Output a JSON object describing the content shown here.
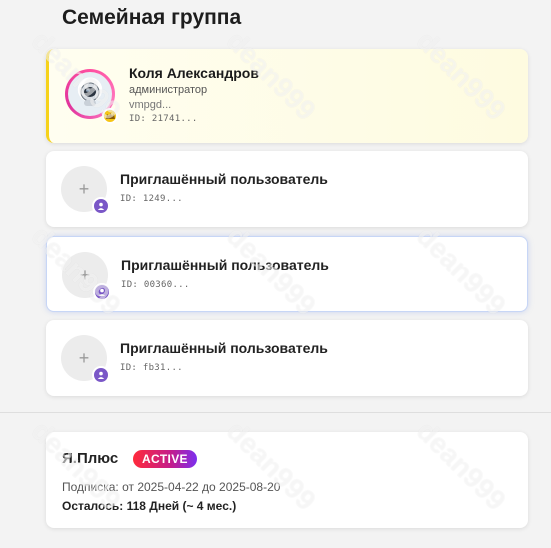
{
  "page": {
    "title": "Семейная группа"
  },
  "admin": {
    "name": "Коля Александров",
    "role": "администратор",
    "email": "vmpgd...",
    "id": "ID: 21741..."
  },
  "members": [
    {
      "title": "Приглашённый пользователь",
      "id": "ID: 1249..."
    },
    {
      "title": "Приглашённый пользователь",
      "id": "ID: 00360..."
    },
    {
      "title": "Приглашённый пользователь",
      "id": "ID: fb31..."
    }
  ],
  "plus": {
    "name": "Я.Плюс",
    "status": "ACTIVE",
    "subscription": "Подписка: от 2025-04-22 до 2025-08-20",
    "remaining": "Осталось: 118 Дней (~ 4 мес.)"
  },
  "icons": {
    "plus": "+",
    "crown_badge": "crown-icon",
    "member_badge": "user-badge-icon"
  },
  "watermark": "dean999",
  "colors": {
    "admin_accent": "#f6d21a",
    "member_badge": "#7a57c7",
    "active_badge_start": "#ff2a3a",
    "active_badge_end": "#7b2ff0"
  }
}
